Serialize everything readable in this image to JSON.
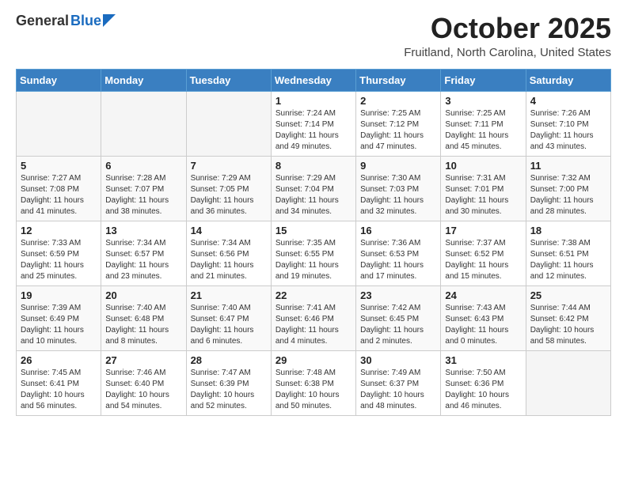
{
  "header": {
    "logo": {
      "general": "General",
      "blue": "Blue"
    },
    "title": "October 2025",
    "location": "Fruitland, North Carolina, United States"
  },
  "days_of_week": [
    "Sunday",
    "Monday",
    "Tuesday",
    "Wednesday",
    "Thursday",
    "Friday",
    "Saturday"
  ],
  "weeks": [
    [
      {
        "day": "",
        "info": ""
      },
      {
        "day": "",
        "info": ""
      },
      {
        "day": "",
        "info": ""
      },
      {
        "day": "1",
        "info": "Sunrise: 7:24 AM\nSunset: 7:14 PM\nDaylight: 11 hours\nand 49 minutes."
      },
      {
        "day": "2",
        "info": "Sunrise: 7:25 AM\nSunset: 7:12 PM\nDaylight: 11 hours\nand 47 minutes."
      },
      {
        "day": "3",
        "info": "Sunrise: 7:25 AM\nSunset: 7:11 PM\nDaylight: 11 hours\nand 45 minutes."
      },
      {
        "day": "4",
        "info": "Sunrise: 7:26 AM\nSunset: 7:10 PM\nDaylight: 11 hours\nand 43 minutes."
      }
    ],
    [
      {
        "day": "5",
        "info": "Sunrise: 7:27 AM\nSunset: 7:08 PM\nDaylight: 11 hours\nand 41 minutes."
      },
      {
        "day": "6",
        "info": "Sunrise: 7:28 AM\nSunset: 7:07 PM\nDaylight: 11 hours\nand 38 minutes."
      },
      {
        "day": "7",
        "info": "Sunrise: 7:29 AM\nSunset: 7:05 PM\nDaylight: 11 hours\nand 36 minutes."
      },
      {
        "day": "8",
        "info": "Sunrise: 7:29 AM\nSunset: 7:04 PM\nDaylight: 11 hours\nand 34 minutes."
      },
      {
        "day": "9",
        "info": "Sunrise: 7:30 AM\nSunset: 7:03 PM\nDaylight: 11 hours\nand 32 minutes."
      },
      {
        "day": "10",
        "info": "Sunrise: 7:31 AM\nSunset: 7:01 PM\nDaylight: 11 hours\nand 30 minutes."
      },
      {
        "day": "11",
        "info": "Sunrise: 7:32 AM\nSunset: 7:00 PM\nDaylight: 11 hours\nand 28 minutes."
      }
    ],
    [
      {
        "day": "12",
        "info": "Sunrise: 7:33 AM\nSunset: 6:59 PM\nDaylight: 11 hours\nand 25 minutes."
      },
      {
        "day": "13",
        "info": "Sunrise: 7:34 AM\nSunset: 6:57 PM\nDaylight: 11 hours\nand 23 minutes."
      },
      {
        "day": "14",
        "info": "Sunrise: 7:34 AM\nSunset: 6:56 PM\nDaylight: 11 hours\nand 21 minutes."
      },
      {
        "day": "15",
        "info": "Sunrise: 7:35 AM\nSunset: 6:55 PM\nDaylight: 11 hours\nand 19 minutes."
      },
      {
        "day": "16",
        "info": "Sunrise: 7:36 AM\nSunset: 6:53 PM\nDaylight: 11 hours\nand 17 minutes."
      },
      {
        "day": "17",
        "info": "Sunrise: 7:37 AM\nSunset: 6:52 PM\nDaylight: 11 hours\nand 15 minutes."
      },
      {
        "day": "18",
        "info": "Sunrise: 7:38 AM\nSunset: 6:51 PM\nDaylight: 11 hours\nand 12 minutes."
      }
    ],
    [
      {
        "day": "19",
        "info": "Sunrise: 7:39 AM\nSunset: 6:49 PM\nDaylight: 11 hours\nand 10 minutes."
      },
      {
        "day": "20",
        "info": "Sunrise: 7:40 AM\nSunset: 6:48 PM\nDaylight: 11 hours\nand 8 minutes."
      },
      {
        "day": "21",
        "info": "Sunrise: 7:40 AM\nSunset: 6:47 PM\nDaylight: 11 hours\nand 6 minutes."
      },
      {
        "day": "22",
        "info": "Sunrise: 7:41 AM\nSunset: 6:46 PM\nDaylight: 11 hours\nand 4 minutes."
      },
      {
        "day": "23",
        "info": "Sunrise: 7:42 AM\nSunset: 6:45 PM\nDaylight: 11 hours\nand 2 minutes."
      },
      {
        "day": "24",
        "info": "Sunrise: 7:43 AM\nSunset: 6:43 PM\nDaylight: 11 hours\nand 0 minutes."
      },
      {
        "day": "25",
        "info": "Sunrise: 7:44 AM\nSunset: 6:42 PM\nDaylight: 10 hours\nand 58 minutes."
      }
    ],
    [
      {
        "day": "26",
        "info": "Sunrise: 7:45 AM\nSunset: 6:41 PM\nDaylight: 10 hours\nand 56 minutes."
      },
      {
        "day": "27",
        "info": "Sunrise: 7:46 AM\nSunset: 6:40 PM\nDaylight: 10 hours\nand 54 minutes."
      },
      {
        "day": "28",
        "info": "Sunrise: 7:47 AM\nSunset: 6:39 PM\nDaylight: 10 hours\nand 52 minutes."
      },
      {
        "day": "29",
        "info": "Sunrise: 7:48 AM\nSunset: 6:38 PM\nDaylight: 10 hours\nand 50 minutes."
      },
      {
        "day": "30",
        "info": "Sunrise: 7:49 AM\nSunset: 6:37 PM\nDaylight: 10 hours\nand 48 minutes."
      },
      {
        "day": "31",
        "info": "Sunrise: 7:50 AM\nSunset: 6:36 PM\nDaylight: 10 hours\nand 46 minutes."
      },
      {
        "day": "",
        "info": ""
      }
    ]
  ]
}
